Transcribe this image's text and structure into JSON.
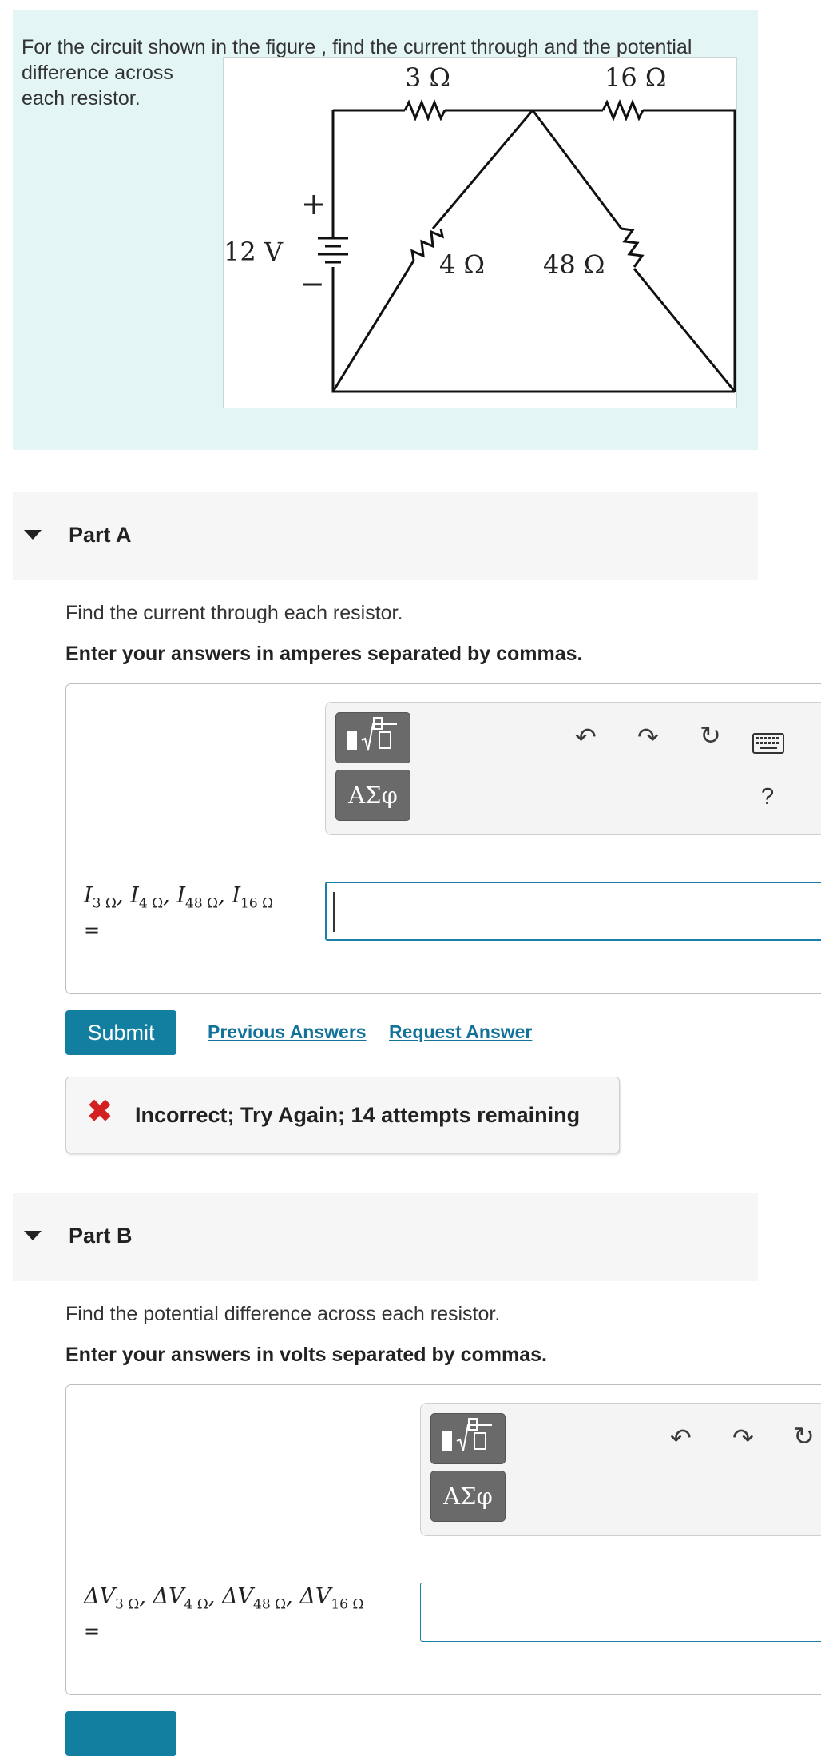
{
  "problem": {
    "line1": "For the circuit shown in the figure , find the current through and the potential",
    "line2": "difference across each resistor.",
    "figure": {
      "r_top_left": "3 Ω",
      "r_top_right": "16 Ω",
      "battery": "12 V",
      "plus": "+",
      "minus": "−",
      "r_left_diag": "4 Ω",
      "r_right_diag": "48 Ω"
    }
  },
  "partA": {
    "title": "Part A",
    "question": "Find the current through each resistor.",
    "instruction": "Enter your answers in amperes separated by commas.",
    "toolbar": {
      "templates_icon": "fraction-radical-template-icon",
      "greek_label": "ΑΣφ",
      "undo_icon": "undo-icon",
      "redo_icon": "redo-icon",
      "reset_icon": "reset-icon",
      "keyboard_icon": "keyboard-icon",
      "help_label": "?"
    },
    "label": {
      "v1": "I",
      "s1": "3 Ω",
      "v2": "I",
      "s2": "4 Ω",
      "v3": "I",
      "s3": "48 Ω",
      "v4": "I",
      "s4": "16 Ω",
      "sep": ", ",
      "equals": "="
    },
    "input_value": "",
    "submit_label": "Submit",
    "previous_answers": "Previous Answers",
    "request_answer": "Request Answer",
    "feedback": "Incorrect; Try Again; 14 attempts remaining",
    "feedback_icon": "✖"
  },
  "partB": {
    "title": "Part B",
    "question": "Find the potential difference across each resistor.",
    "instruction": "Enter your answers in volts separated by commas.",
    "toolbar": {
      "greek_label": "ΑΣφ"
    },
    "label": {
      "delta": "Δ",
      "v1": "V",
      "s1": "3 Ω",
      "v2": "V",
      "s2": "4 Ω",
      "v3": "V",
      "s3": "48 Ω",
      "v4": "V",
      "s4": "16 Ω",
      "sep": ", ",
      "equals": "="
    },
    "input_value": ""
  },
  "colors": {
    "problem_bg": "#e3f5f5",
    "accent": "#127fa1",
    "error": "#d42020"
  }
}
